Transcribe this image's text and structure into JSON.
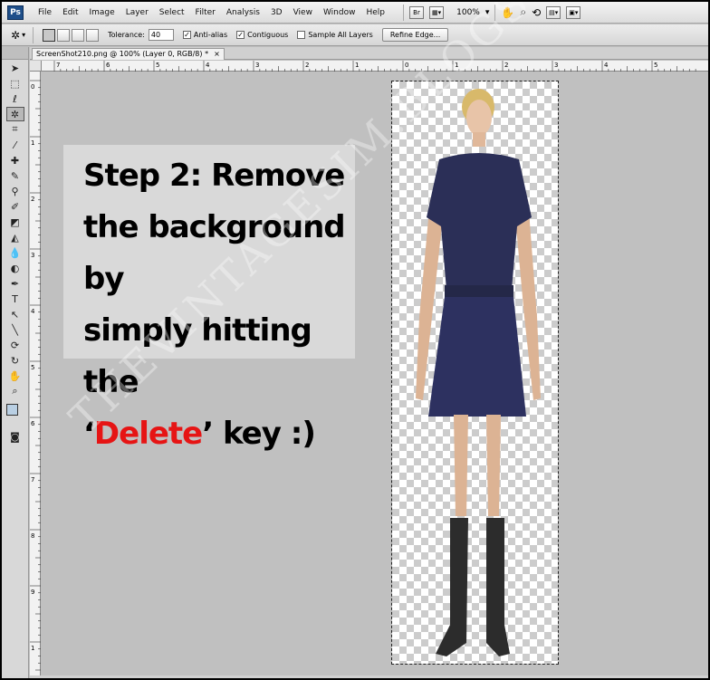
{
  "app": {
    "logo": "Ps"
  },
  "menu": [
    "File",
    "Edit",
    "Image",
    "Layer",
    "Select",
    "Filter",
    "Analysis",
    "3D",
    "View",
    "Window",
    "Help"
  ],
  "menubar": {
    "zoom": "100%",
    "br_label": "Br"
  },
  "options": {
    "tolerance_label": "Tolerance:",
    "tolerance_value": "40",
    "anti_alias_label": "Anti-alias",
    "anti_alias_checked": true,
    "contiguous_label": "Contiguous",
    "contiguous_checked": true,
    "sample_all_layers_label": "Sample All Layers",
    "sample_all_layers_checked": false,
    "refine_edge_label": "Refine Edge..."
  },
  "document": {
    "tab_title": "ScreenShot210.png @ 100% (Layer 0, RGB/8) *",
    "close_glyph": "×"
  },
  "rulers": {
    "h_ticks": [
      "7",
      "6",
      "5",
      "4",
      "3",
      "2",
      "1",
      "0",
      "1",
      "2",
      "3",
      "4",
      "5"
    ],
    "v_ticks": [
      "0",
      "1",
      "2",
      "3",
      "4",
      "5",
      "6",
      "7",
      "8",
      "9",
      "1"
    ]
  },
  "overlay": {
    "line1": "Step 2: Remove",
    "line2": "the background by",
    "line3": "simply hitting the",
    "quote_open": "‘",
    "key_word": "Delete",
    "line4_rest": "’ key :)"
  },
  "watermark": "THEVINTAGESIM.BLOGSPOT.COM",
  "colors": {
    "foreground": "#b9cfe3",
    "accent_red": "#e61414"
  },
  "tools": [
    "move-tool",
    "marquee-tool",
    "lasso-tool",
    "magic-wand-tool",
    "crop-tool",
    "eyedropper-tool",
    "healing-tool",
    "brush-tool",
    "clone-stamp-tool",
    "history-brush-tool",
    "eraser-tool",
    "gradient-tool",
    "blur-tool",
    "dodge-tool",
    "pen-tool",
    "type-tool",
    "path-selection-tool",
    "line-tool",
    "3d-rotate-tool",
    "3d-orbit-tool",
    "hand-tool",
    "zoom-tool"
  ]
}
